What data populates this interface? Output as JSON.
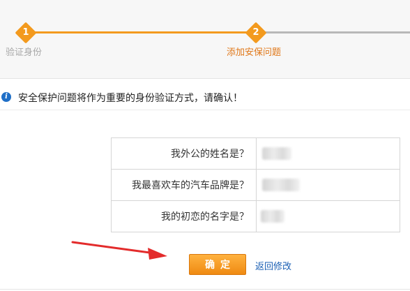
{
  "steps": [
    {
      "number": "1",
      "label": "验证身份",
      "state": "done"
    },
    {
      "number": "2",
      "label": "添加安保问题",
      "state": "current"
    }
  ],
  "notice": {
    "icon": "info-icon",
    "text": "安全保护问题将作为重要的身份验证方式，请确认！"
  },
  "questions": [
    {
      "question": "我外公的姓名是？",
      "answer": ""
    },
    {
      "question": "我最喜欢车的汽车品牌是？",
      "answer": ""
    },
    {
      "question": "我的初恋的名字是？",
      "answer": ""
    }
  ],
  "actions": {
    "confirm_label": "确定",
    "back_label": "返回修改"
  },
  "colors": {
    "accent": "#f39a1e",
    "current_step_text": "#e0781a",
    "link": "#1a5fb4",
    "info_icon": "#1f6fc7"
  }
}
